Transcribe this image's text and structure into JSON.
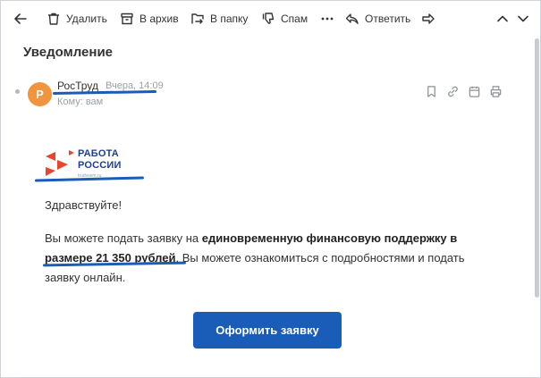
{
  "toolbar": {
    "delete_label": "Удалить",
    "archive_label": "В архив",
    "move_label": "В папку",
    "spam_label": "Спам",
    "reply_label": "Ответить",
    "icons": [
      "back-arrow-icon",
      "trash-icon",
      "archive-icon",
      "folder-move-icon",
      "thumb-down-icon",
      "more-icon",
      "reply-icon",
      "forward-icon",
      "chevron-up-icon",
      "chevron-down-icon"
    ]
  },
  "message": {
    "title": "Уведомление",
    "avatar_letter": "Р",
    "sender": "РосТруд",
    "date": "Вчера, 14:09",
    "recipient": "Кому: вам",
    "actions": [
      "bookmark-icon",
      "link-icon",
      "calendar-icon",
      "print-icon"
    ]
  },
  "logo": {
    "line1": "РАБОТА",
    "line2": "РОССИИ",
    "small": "trudvsem.ru"
  },
  "body": {
    "greeting": "Здравствуйте!",
    "text_before": "Вы можете подать заявку на ",
    "text_bold": "единовременную финансовую поддержку в размере 21 350 рублей",
    "text_after": ". Вы можете ознакомиться с подробностями и подать заявку онлайн."
  },
  "cta": {
    "label": "Оформить заявку"
  },
  "colors": {
    "accent": "#1a5db8",
    "avatar": "#f0943f",
    "logo_red": "#e8452c",
    "logo_blue": "#1e3f8c"
  }
}
